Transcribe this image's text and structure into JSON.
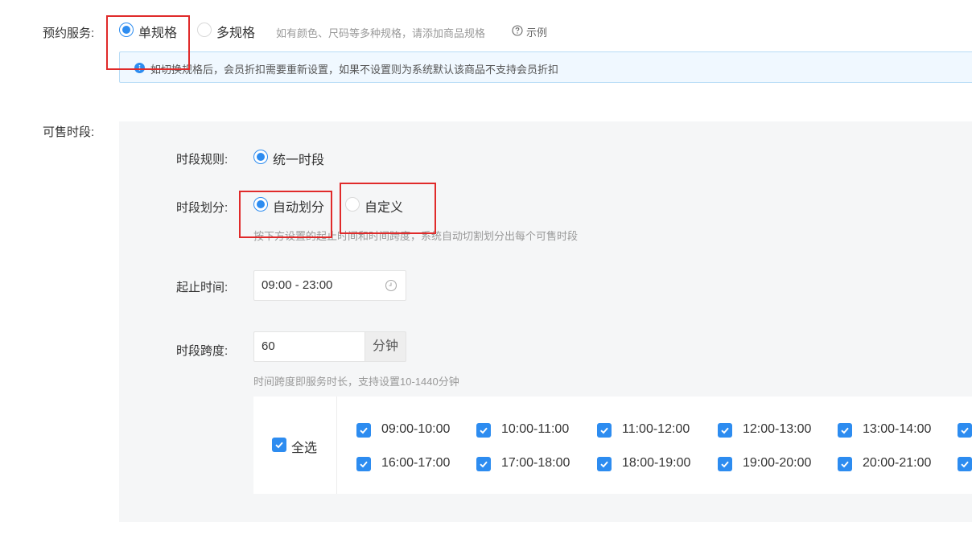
{
  "service": {
    "label": "预约服务:",
    "options": [
      "单规格",
      "多规格"
    ],
    "selected": "单规格",
    "hint": "如有颜色、尺码等多种规格，请添加商品规格",
    "example_label": "示例",
    "info": "如切换规格后，会员折扣需要重新设置，如果不设置则为系统默认该商品不支持会员折扣"
  },
  "sale_period": {
    "label": "可售时段:",
    "rule": {
      "label": "时段规则:",
      "option": "统一时段"
    },
    "division": {
      "label": "时段划分:",
      "options": [
        "自动划分",
        "自定义"
      ],
      "selected": "自动划分",
      "hint": "按下方设置的起止时间和时间跨度，系统自动切割划分出每个可售时段"
    },
    "time_range": {
      "label": "起止时间:",
      "value": "09:00 - 23:00"
    },
    "span": {
      "label": "时段跨度:",
      "value": "60",
      "unit": "分钟",
      "hint": "时间跨度即服务时长，支持设置10-1440分钟"
    },
    "select_all": "全选",
    "slots": [
      "09:00-10:00",
      "10:00-11:00",
      "11:00-12:00",
      "12:00-13:00",
      "13:00-14:00",
      "16:00-17:00",
      "17:00-18:00",
      "18:00-19:00",
      "19:00-20:00",
      "20:00-21:00"
    ]
  },
  "colors": {
    "accent": "#2d8cf0",
    "highlight": "#e02a2a",
    "panel_bg": "#f5f6f7",
    "info_bg": "#f0f8ff"
  }
}
